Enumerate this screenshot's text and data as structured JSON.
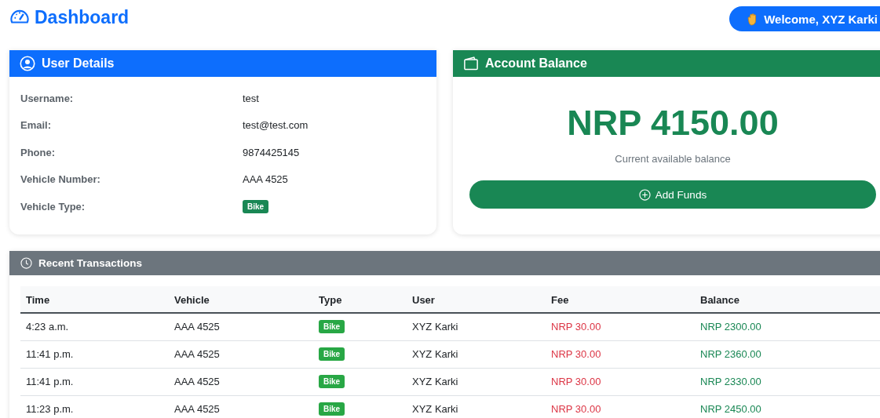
{
  "header": {
    "title": "Dashboard",
    "welcome": "Welcome, XYZ Karki"
  },
  "user_details": {
    "title": "User Details",
    "fields": [
      {
        "label": "Username:",
        "value": "test",
        "kind": "text"
      },
      {
        "label": "Email:",
        "value": "test@test.com",
        "kind": "text"
      },
      {
        "label": "Phone:",
        "value": "9874425145",
        "kind": "text"
      },
      {
        "label": "Vehicle Number:",
        "value": "AAA 4525",
        "kind": "text"
      },
      {
        "label": "Vehicle Type:",
        "value": "Bike",
        "kind": "badge"
      }
    ]
  },
  "account_balance": {
    "title": "Account Balance",
    "amount": "NRP 4150.00",
    "caption": "Current available balance",
    "button": "Add Funds"
  },
  "transactions": {
    "title": "Recent Transactions",
    "columns": [
      "Time",
      "Vehicle",
      "Type",
      "User",
      "Fee",
      "Balance"
    ],
    "rows": [
      {
        "time": "4:23 a.m.",
        "vehicle": "AAA 4525",
        "type": "Bike",
        "user": "XYZ Karki",
        "fee": "NRP 30.00",
        "balance": "NRP 2300.00"
      },
      {
        "time": "11:41 p.m.",
        "vehicle": "AAA 4525",
        "type": "Bike",
        "user": "XYZ Karki",
        "fee": "NRP 30.00",
        "balance": "NRP 2360.00"
      },
      {
        "time": "11:41 p.m.",
        "vehicle": "AAA 4525",
        "type": "Bike",
        "user": "XYZ Karki",
        "fee": "NRP 30.00",
        "balance": "NRP 2330.00"
      },
      {
        "time": "11:23 p.m.",
        "vehicle": "AAA 4525",
        "type": "Bike",
        "user": "XYZ Karki",
        "fee": "NRP 30.00",
        "balance": "NRP 2450.00"
      }
    ]
  }
}
